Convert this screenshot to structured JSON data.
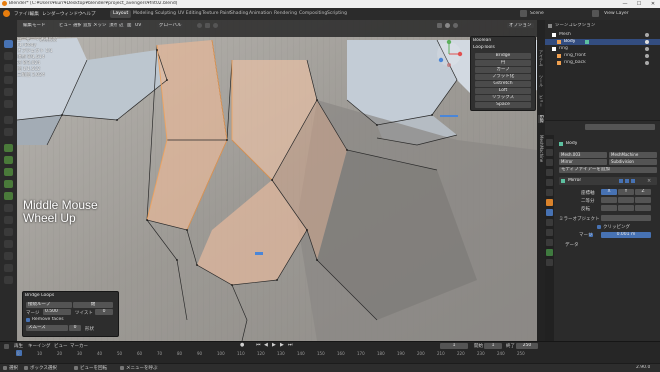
{
  "window": {
    "title": "Blender* [C:¥Users¥kurr¥Desktop¥blender¥project_avengers¥fnt02.blend]",
    "minimize": "—",
    "maximize": "☐",
    "close": "✕"
  },
  "menubar": {
    "items": [
      "ファイル",
      "編集",
      "レンダー",
      "ウィンドウ",
      "ヘルプ"
    ],
    "workspaces": [
      "Layout",
      "Modeling",
      "Sculpting",
      "UV Editing",
      "Texture Paint",
      "Shading",
      "Animation",
      "Rendering",
      "Compositing",
      "Scripting"
    ],
    "active_workspace": "Layout",
    "scene_label": "Scene",
    "view_layer_label": "View Layer"
  },
  "viewport_header": {
    "mode": "編集モード",
    "menus": [
      "ビュー",
      "選択",
      "追加",
      "メッシュ",
      "頂点",
      "辺",
      "面",
      "UV"
    ],
    "orientation": "グローバル",
    "options_label": "オプション"
  },
  "viewport_overlay": {
    "view_name": "ユーザー・透視投影",
    "object_name": "(1) Body",
    "stats": [
      "オブジェクト 1/1",
      "頂点 8/1,514",
      "辺 8/3,024",
      "面 1/1,512",
      "三角面 3,024"
    ]
  },
  "key_hint": {
    "line1": "Middle Mouse",
    "line2": "Wheel Up"
  },
  "npanel": {
    "sections": [
      "Boolean",
      "LoopTools"
    ],
    "buttons": [
      "Bridge",
      "円",
      "カーブ",
      "フラット化",
      "Gstretch",
      "Loft",
      "リラックス",
      "Space"
    ],
    "tabs": [
      "アイテム",
      "ツール",
      "ビュー",
      "Edit",
      "MeshMachine"
    ]
  },
  "operator_panel": {
    "title": "Bridge Loops",
    "connect_label": "接続ループ",
    "connect_value": "閉",
    "merge_label": "マージ",
    "factor_label": "係数",
    "factor_value": "0.500",
    "twist_label": "ツイスト",
    "twist_value": "0",
    "segments_label": "分割数",
    "segments_value": "1",
    "remove_faces": "Remove faces",
    "profile_label": "スムーズ",
    "profile_value": "0",
    "extra": "形状"
  },
  "outliner": {
    "title": "シーンコレクション",
    "items": [
      {
        "label": "Mesh",
        "depth": 1,
        "selected": false
      },
      {
        "label": "Body",
        "depth": 2,
        "selected": true
      },
      {
        "label": "ring",
        "depth": 1,
        "selected": false
      },
      {
        "label": "ring_front",
        "depth": 2,
        "selected": false
      },
      {
        "label": "ring_back",
        "depth": 2,
        "selected": false
      }
    ]
  },
  "properties": {
    "search": "",
    "object_name": "Body",
    "row1_left": "Mesh.003",
    "row1_right": "MeshMachine",
    "row2_left": "Mirror",
    "row2_right": "Subdivision",
    "add_modifier": "モディファイアーを追加",
    "modifier_name": "Mirror",
    "axis_label": "座標軸",
    "bisect_label": "二等分",
    "flip_label": "反転",
    "axes": [
      "X",
      "Y",
      "Z"
    ],
    "mirror_object_label": "ミラーオブジェクト",
    "clipping_label": "クリッピング",
    "merge_label": "マージ",
    "merge_value": "0.001 m",
    "data_label": "データ"
  },
  "timeline": {
    "menus": [
      "再生",
      "キーイング",
      "ビュー",
      "マーカー"
    ],
    "frames": [
      "0",
      "10",
      "20",
      "30",
      "40",
      "50",
      "60",
      "70",
      "80",
      "90",
      "100",
      "110",
      "120",
      "130",
      "140",
      "150",
      "160",
      "170",
      "180",
      "190",
      "200",
      "210",
      "220",
      "230",
      "240",
      "250"
    ],
    "current_frame": "1",
    "start_label": "開始",
    "start_value": "1",
    "end_label": "終了",
    "end_value": "250"
  },
  "statusbar": {
    "items": [
      "選択",
      "ボックス選択",
      "ビューを回転",
      "メニューを呼ぶ"
    ],
    "version": "2.90.0"
  },
  "colors": {
    "accent": "#4772b3",
    "selection": "#f2a25a",
    "viewport_bg": "#a7a6a3"
  }
}
